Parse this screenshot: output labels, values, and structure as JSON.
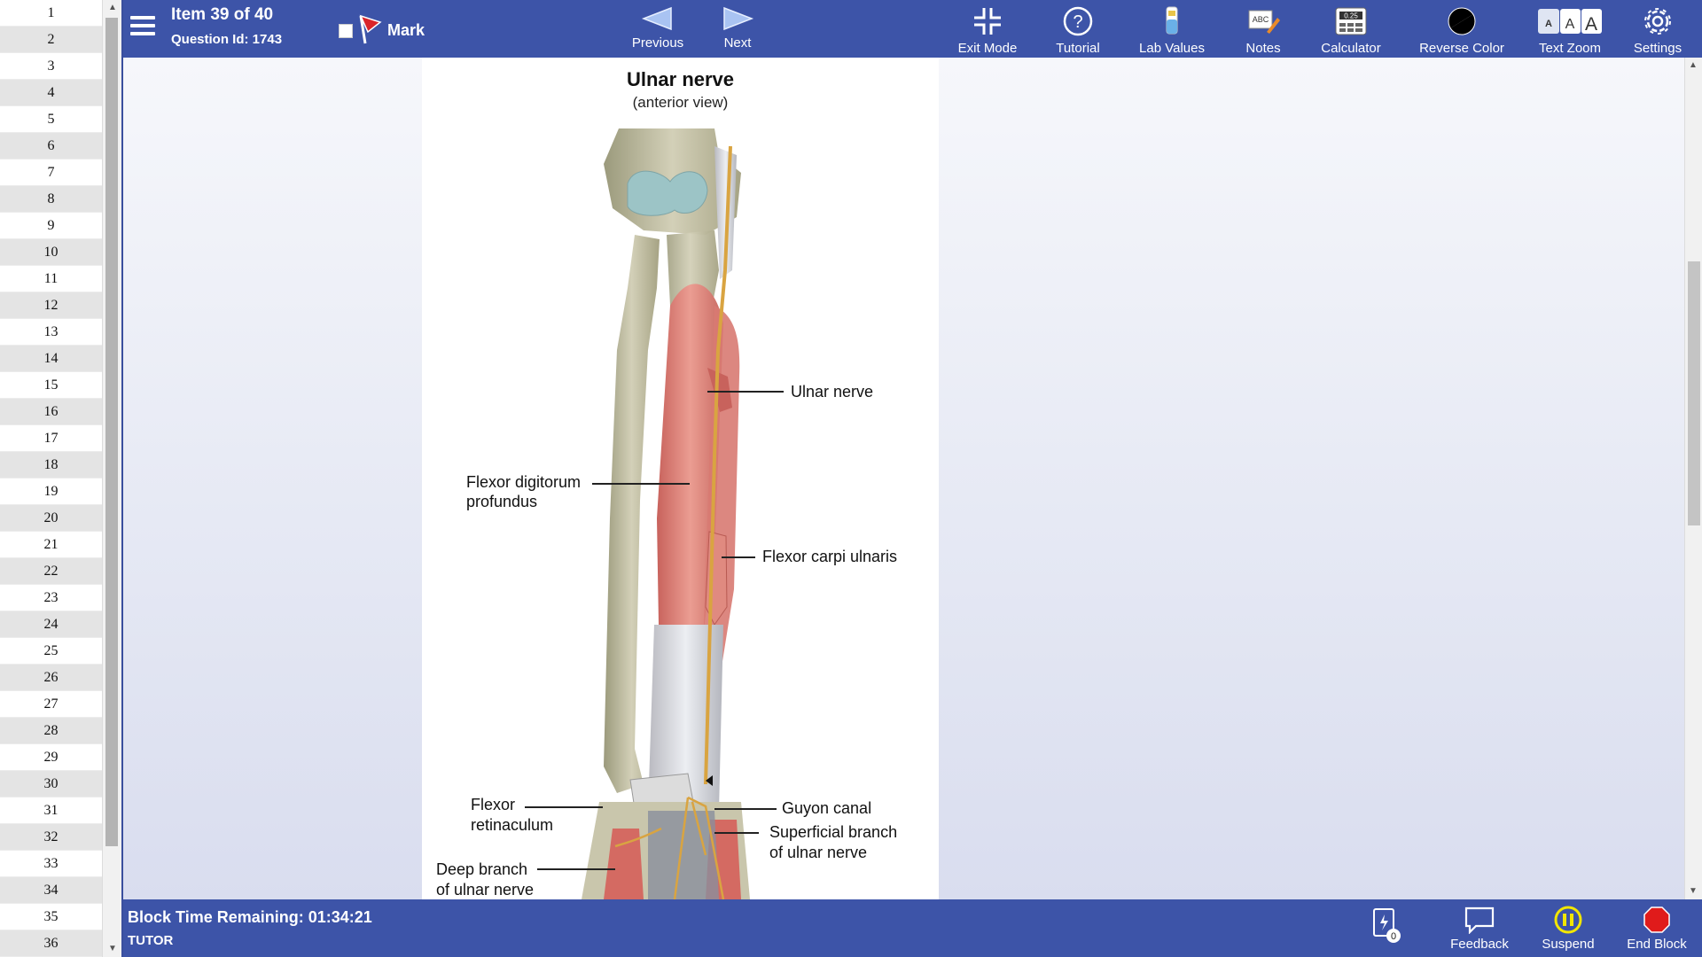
{
  "item_list": {
    "numbers": [
      "1",
      "2",
      "3",
      "4",
      "5",
      "6",
      "7",
      "8",
      "9",
      "10",
      "11",
      "12",
      "13",
      "14",
      "15",
      "16",
      "17",
      "18",
      "19",
      "20",
      "21",
      "22",
      "23",
      "24",
      "25",
      "26",
      "27",
      "28",
      "29",
      "30",
      "31",
      "32",
      "33",
      "34",
      "35",
      "36"
    ]
  },
  "header": {
    "item_counter": "Item 39 of 40",
    "question_id": "Question Id: 1743",
    "mark_label": "Mark",
    "previous_label": "Previous",
    "next_label": "Next",
    "exit_mode_label": "Exit Mode",
    "tutorial_label": "Tutorial",
    "lab_values_label": "Lab Values",
    "notes_label": "Notes",
    "calculator_label": "Calculator",
    "calculator_display": "0.25",
    "notes_icon_text": "ABC",
    "reverse_color_label": "Reverse Color",
    "text_zoom_label": "Text Zoom",
    "text_zoom_letters": [
      "A",
      "A",
      "A"
    ],
    "settings_label": "Settings"
  },
  "figure": {
    "title": "Ulnar nerve",
    "subtitle": "(anterior view)",
    "labels": {
      "ulnar_nerve": "Ulnar nerve",
      "fdp_line1": "Flexor digitorum",
      "fdp_line2": "profundus",
      "fcu": "Flexor carpi ulnaris",
      "retinaculum_line1": "Flexor",
      "retinaculum_line2": "retinaculum",
      "guyon": "Guyon canal",
      "superficial_line1": "Superficial branch",
      "superficial_line2": "of ulnar nerve",
      "deep_line1": "Deep branch",
      "deep_line2": "of ulnar nerve"
    }
  },
  "footer": {
    "timer": "Block Time Remaining: 01:34:21",
    "mode": "TUTOR",
    "flashcard_count": "0",
    "feedback_label": "Feedback",
    "suspend_label": "Suspend",
    "end_block_label": "End Block"
  },
  "colors": {
    "toolbar": "#3d54a8",
    "mark_flag": "#d9242a",
    "suspend": "#f2e600",
    "end_block": "#e01b1b"
  }
}
